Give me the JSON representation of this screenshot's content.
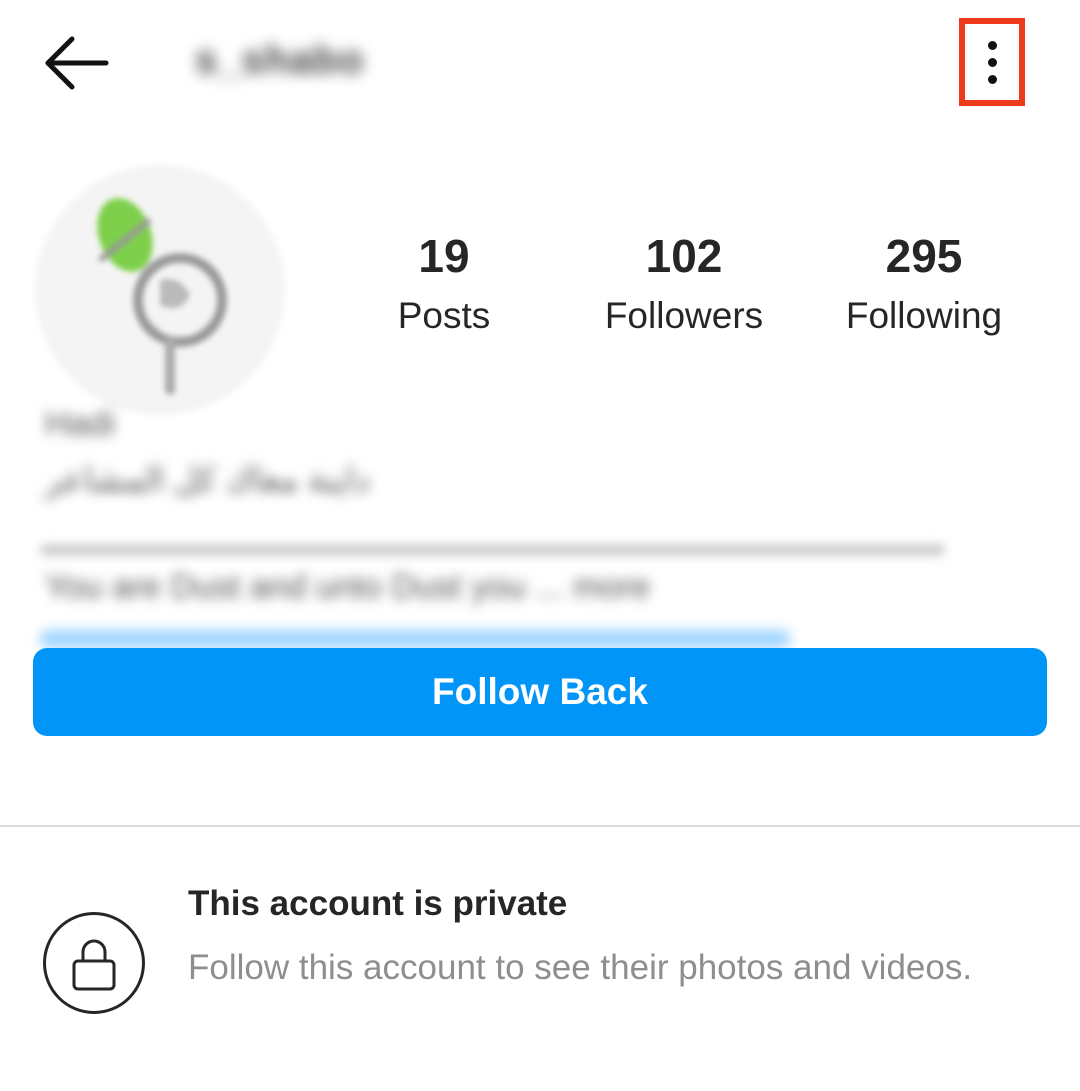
{
  "header": {
    "username": "s_shabo",
    "back_icon": "arrow-left-icon",
    "more_icon": "vertical-dots-icon",
    "highlight_color": "#ee3a1c"
  },
  "profile": {
    "bio_line1": "Hadi",
    "bio_line2": "داينة معاك كل المشاعر",
    "bio_line3": "You are Dust and unto Dust you ... more"
  },
  "stats": {
    "posts": {
      "value": "19",
      "label": "Posts"
    },
    "followers": {
      "value": "102",
      "label": "Followers"
    },
    "following": {
      "value": "295",
      "label": "Following"
    }
  },
  "actions": {
    "follow_label": "Follow Back",
    "follow_color": "#0095f6"
  },
  "private_notice": {
    "icon": "lock-icon",
    "title": "This account is private",
    "subtitle": "Follow this account to see their photos and videos."
  }
}
